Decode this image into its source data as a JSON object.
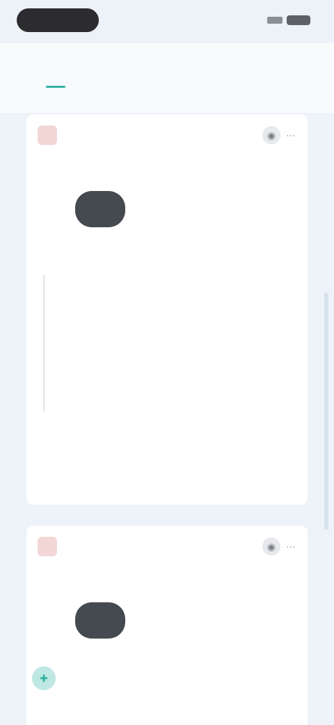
{
  "tabs": [
    {
      "label": "",
      "active": true
    },
    {
      "label": "",
      "active": false
    },
    {
      "label": "",
      "active": false
    }
  ],
  "cards": [
    {
      "badge": "",
      "title": "",
      "meta_left": "",
      "meta_right": "",
      "person_name": "",
      "person_meta": "",
      "person_status": "",
      "caption": "",
      "body_text": "",
      "body_footnote": "",
      "footer": ""
    },
    {
      "badge": "",
      "title": "",
      "meta_left": "",
      "meta_right": "",
      "person_name": "",
      "person_meta": "",
      "person_status": "",
      "caption": ""
    }
  ],
  "colors": {
    "accent": "#34b2a2",
    "badge_bg": "#f3d7d7",
    "badge_fg": "#d9534f",
    "page_bg": "#eef3f9"
  },
  "icons": {
    "status": [
      "signal-icon",
      "battery-icon"
    ],
    "card_action": "chat-icon",
    "fab": "plus-icon"
  }
}
